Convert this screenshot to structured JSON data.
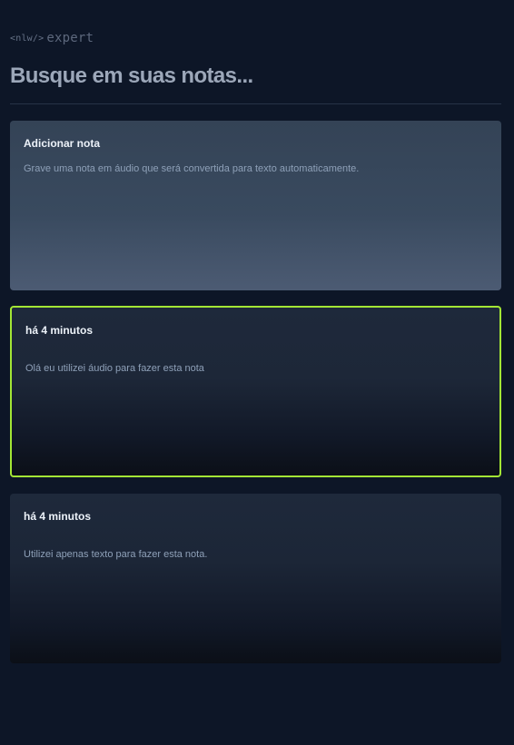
{
  "logo": {
    "text_left": "<nlw/>",
    "text_right": "expert"
  },
  "search": {
    "placeholder": "Busque em suas notas..."
  },
  "cards": {
    "new_note": {
      "title": "Adicionar nota",
      "description": "Grave uma nota em áudio que será convertida para texto automaticamente."
    },
    "notes": [
      {
        "time": "há 4 minutos",
        "content": "Olá eu utilizei áudio para fazer esta nota",
        "highlighted": true
      },
      {
        "time": "há 4 minutos",
        "content": "Utilizei apenas texto para fazer esta nota.",
        "highlighted": false
      }
    ]
  },
  "colors": {
    "background": "#0d1627",
    "accent": "#a3e635",
    "new_note_card": "#344356",
    "note_card": "#1e293b"
  }
}
